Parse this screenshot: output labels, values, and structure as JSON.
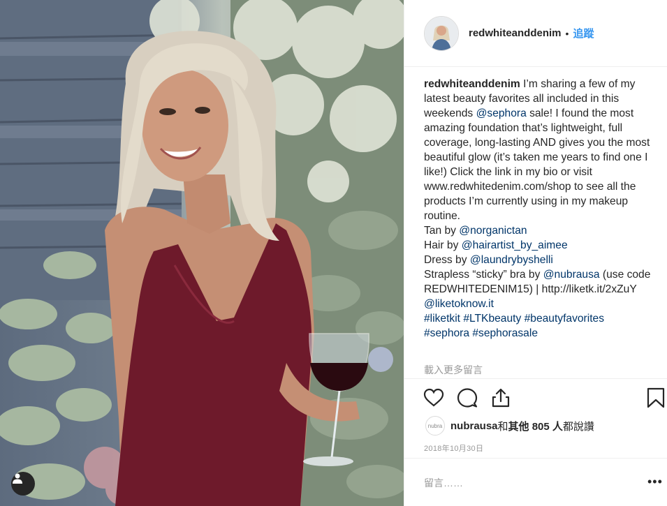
{
  "post": {
    "username": "redwhiteanddenim",
    "separator": "•",
    "follow_label": "追蹤",
    "caption": {
      "username": "redwhiteanddenim",
      "segments": [
        {
          "t": " I’m sharing a few of my latest beauty favorites all included in this weekends ",
          "link": false
        },
        {
          "t": "@sephora",
          "link": true
        },
        {
          "t": " sale! I found the most amazing foundation that’s lightweight, full coverage, long-lasting AND gives you the most beautiful glow (it’s taken me years to find one I like!) Click the link in my bio or visit www.redwhitedenim.com/shop to see all the products I’m currently using in my makeup routine.",
          "link": false
        }
      ],
      "credits": [
        {
          "prefix": "Tan by ",
          "handle": "@norganictan",
          "suffix": ""
        },
        {
          "prefix": "Hair by ",
          "handle": "@hairartist_by_aimee",
          "suffix": ""
        },
        {
          "prefix": "Dress by ",
          "handle": "@laundrybyshelli",
          "suffix": ""
        },
        {
          "prefix": "Strapless “sticky” bra by ",
          "handle": "@nubrausa",
          "suffix": " (use code REDWHITEDENIM15) | http://liketk.it/2xZuY "
        }
      ],
      "trailing_link": "@liketoknow.it",
      "hashtags_line1": "#liketkit #LTKbeauty #beautyfavorites",
      "hashtags_line2": "#sephora #sephorasale"
    },
    "load_more": "載入更多留言",
    "likes": {
      "avatar_text": "nubra",
      "liker": "nubrausa",
      "and": " 和 ",
      "others": "其他 805 人",
      "suffix": " 都說讚"
    },
    "date": "2018年10月30日",
    "comment_placeholder": "留言……",
    "menu_icon": "more-dots-icon",
    "icons": [
      "heart-icon",
      "comment-icon",
      "share-icon",
      "bookmark-icon",
      "user-tag-icon"
    ]
  }
}
